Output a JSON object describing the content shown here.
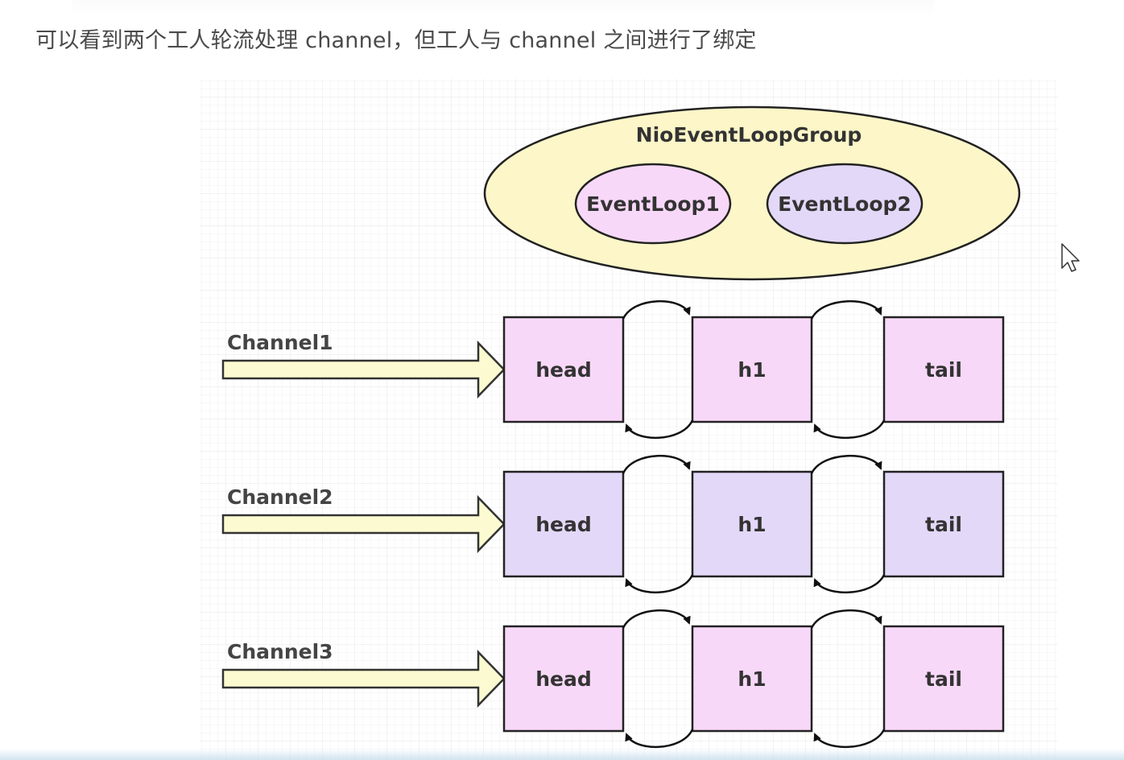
{
  "caption": "可以看到两个工人轮流处理 channel，但工人与 channel 之间进行了绑定",
  "group": {
    "title": "NioEventLoopGroup",
    "loops": [
      {
        "label": "EventLoop1",
        "color": "#f8d8f8"
      },
      {
        "label": "EventLoop2",
        "color": "#e3d8f8"
      }
    ],
    "color": "#fcf6c8"
  },
  "channels": [
    {
      "label": "Channel1",
      "color": "#f8d8f8",
      "handlers": [
        "head",
        "h1",
        "tail"
      ]
    },
    {
      "label": "Channel2",
      "color": "#e3d8f8",
      "handlers": [
        "head",
        "h1",
        "tail"
      ]
    },
    {
      "label": "Channel3",
      "color": "#f8d8f8",
      "handlers": [
        "head",
        "h1",
        "tail"
      ]
    }
  ],
  "colors": {
    "arrow_fill": "#fcfad0",
    "stroke": "#222222",
    "grid": "#ececec"
  },
  "icons": {
    "cursor": "mouse-pointer-icon"
  }
}
